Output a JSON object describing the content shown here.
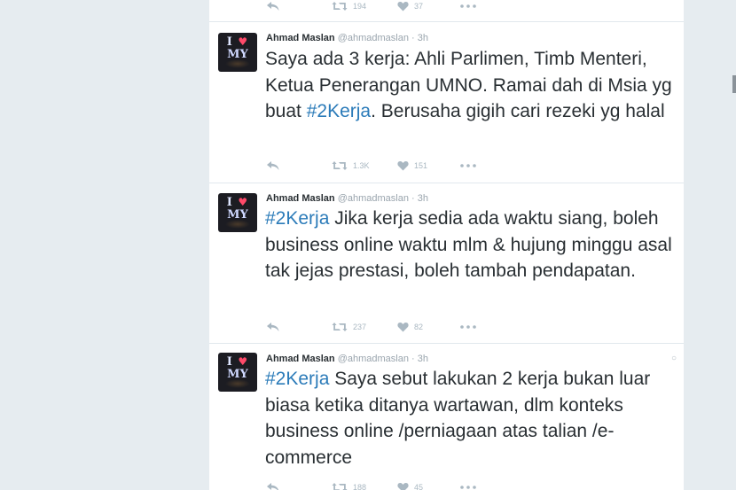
{
  "tweets": [
    {
      "author_name": "",
      "handle": "",
      "time": "",
      "text_plain": "",
      "hashtag": "",
      "text_after": "",
      "replies": "",
      "retweets": "194",
      "likes": "37"
    },
    {
      "author_name": "Ahmad Maslan",
      "handle": "@ahmadmaslan",
      "time": "· 3h",
      "text_plain": "Saya ada 3 kerja: Ahli Parlimen, Timb Menteri, Ketua Penerangan UMNO. Ramai dah di Msia yg buat ",
      "hashtag": "#2Kerja",
      "text_after": ". Berusaha gigih cari rezeki yg halal",
      "retweets": "1.3K",
      "likes": "151"
    },
    {
      "author_name": "Ahmad Maslan",
      "handle": "@ahmadmaslan",
      "time": "· 3h",
      "hashtag": "#2Kerja",
      "text_after": " Jika kerja sedia ada waktu siang, boleh business online waktu mlm & hujung minggu asal tak jejas prestasi, boleh tambah pendapatan.",
      "retweets": "237",
      "likes": "82"
    },
    {
      "author_name": "Ahmad Maslan",
      "handle": "@ahmadmaslan",
      "time": "· 3h",
      "hashtag": "#2Kerja",
      "text_after": " Saya sebut lakukan 2 kerja bukan luar biasa ketika ditanya wartawan, dlm konteks business online /perniagaan atas talian /e-commerce",
      "retweets": "188",
      "likes": "45"
    }
  ],
  "avatar": {
    "line1_left": "I",
    "line1_right": "",
    "line2": "MY"
  },
  "colors": {
    "background": "#e6ecf0",
    "card": "#ffffff",
    "hashtag": "#2b7bb9",
    "text": "#292f33",
    "muted": "#aab8c2"
  },
  "icons": {
    "reply": "reply-icon",
    "retweet": "retweet-icon",
    "like": "heart-icon",
    "more": "more-dots-icon",
    "caret": "caret-down-icon"
  }
}
